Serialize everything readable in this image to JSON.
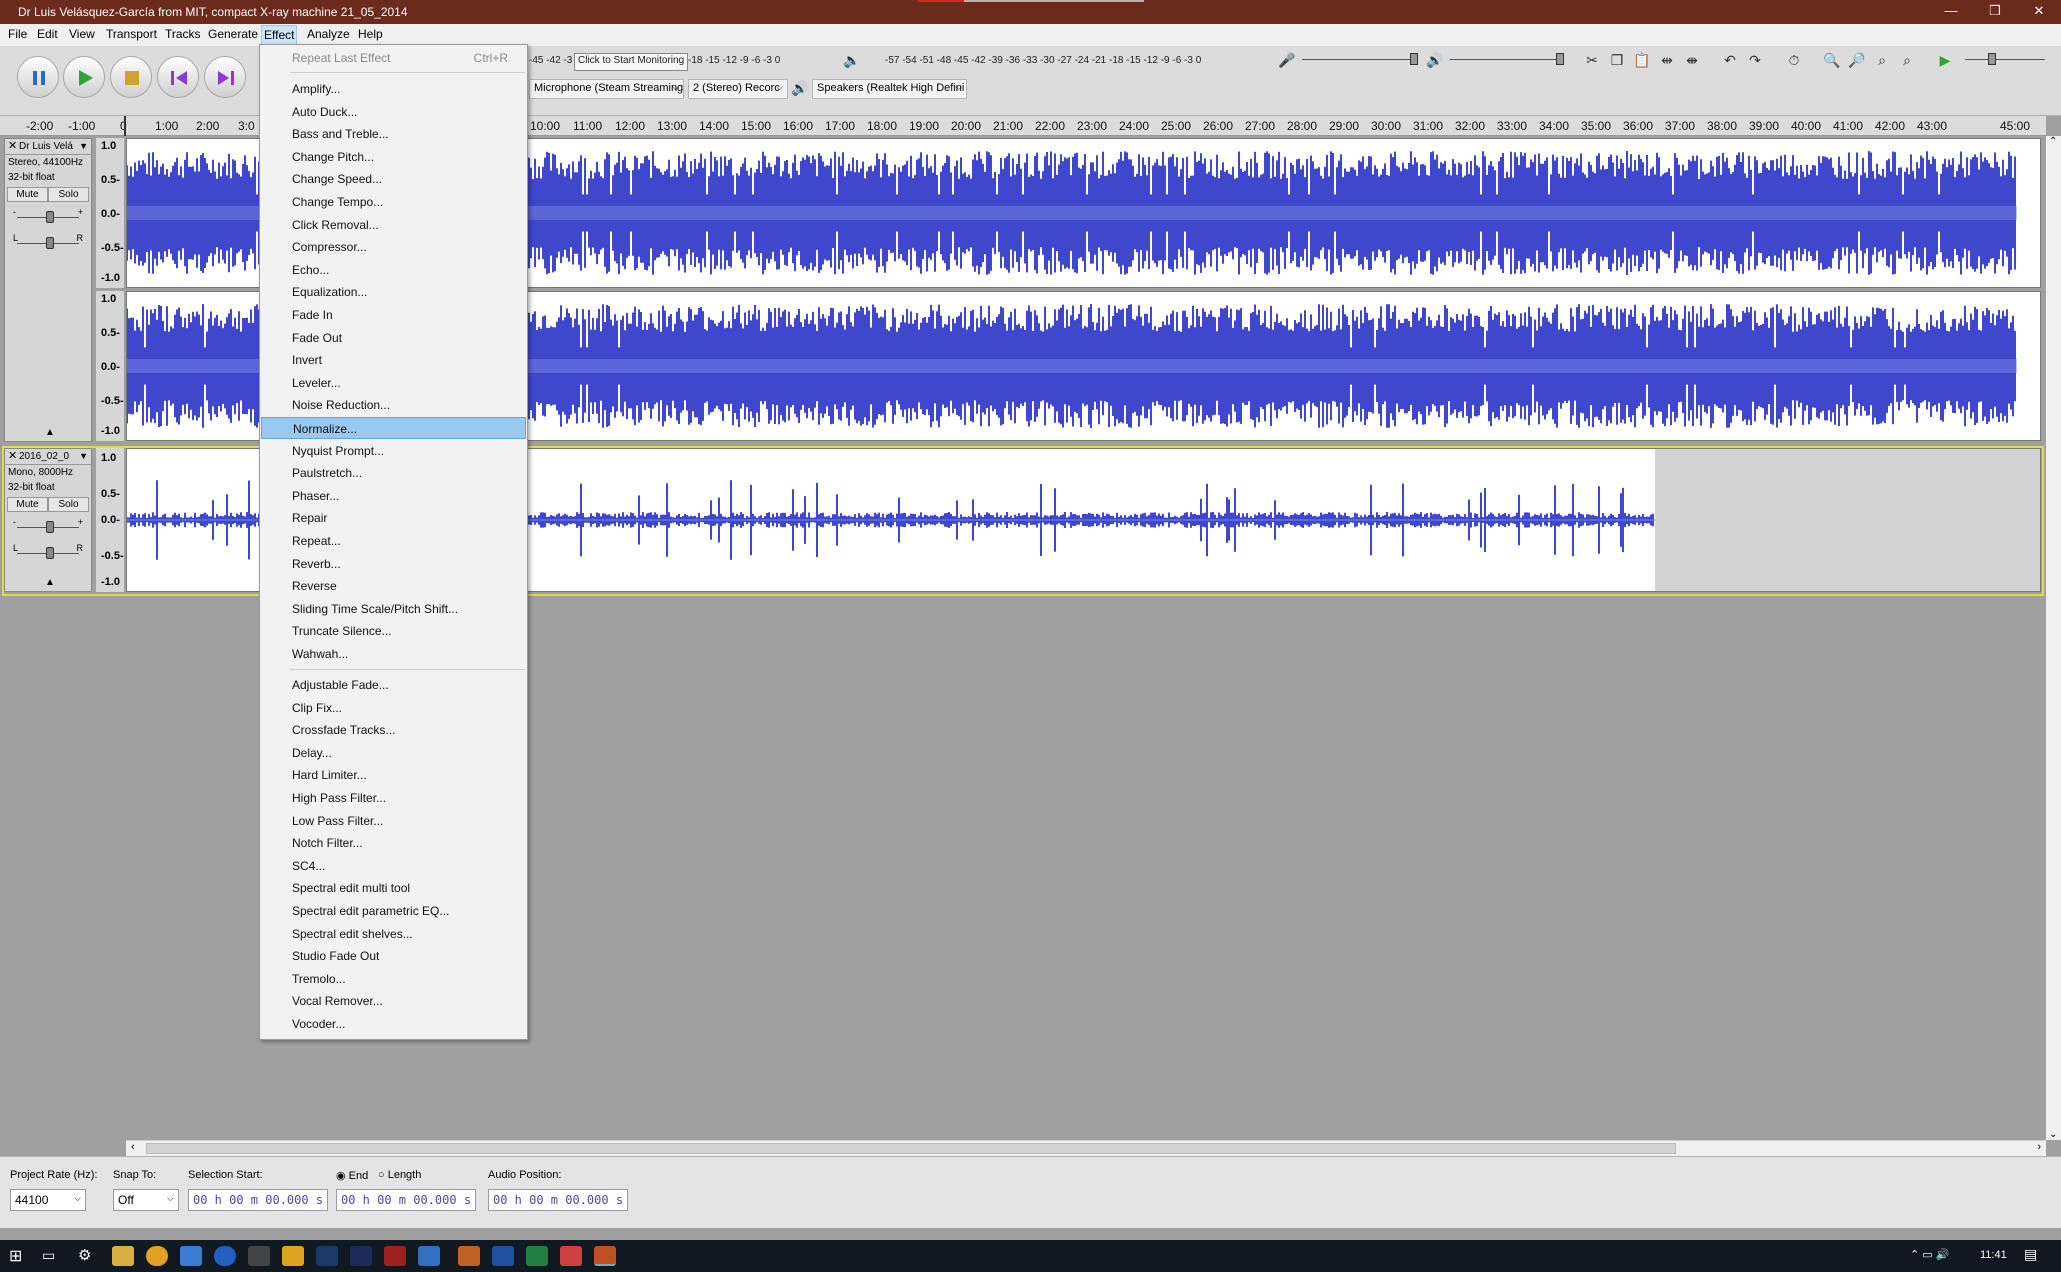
{
  "window": {
    "title": "Dr Luis Velásquez-García from MIT, compact X-ray machine 21_05_2014",
    "minimize": "—",
    "restore": "❐",
    "close": "✕"
  },
  "menubar": [
    "File",
    "Edit",
    "View",
    "Transport",
    "Tracks",
    "Generate",
    "Effect",
    "Analyze",
    "Help"
  ],
  "toolbar": {
    "rec_meter_ticks": "-45 -42 -3",
    "monitor_tip": "Click to Start Monitoring",
    "rec_meter_ticks2": "-18 -15 -12 -9 -6 -3 0",
    "play_meter_ticks": "-57 -54 -51 -48 -45 -42 -39 -36 -33 -30 -27 -24 -21 -18 -15 -12 -9 -6 -3 0",
    "mic_device": "Microphone (Steam Streaming",
    "channels": "2 (Stereo) Recorc",
    "speaker_device": "Speakers (Realtek High Defini"
  },
  "ruler": [
    "-2:00",
    "-1:00",
    "0",
    "1:00",
    "2:00",
    "3:0",
    "10:00",
    "11:00",
    "12:00",
    "13:00",
    "14:00",
    "15:00",
    "16:00",
    "17:00",
    "18:00",
    "19:00",
    "20:00",
    "21:00",
    "22:00",
    "23:00",
    "24:00",
    "25:00",
    "26:00",
    "27:00",
    "28:00",
    "29:00",
    "30:00",
    "31:00",
    "32:00",
    "33:00",
    "34:00",
    "35:00",
    "36:00",
    "37:00",
    "38:00",
    "39:00",
    "40:00",
    "41:00",
    "42:00",
    "43:00",
    "45:00"
  ],
  "tracks": [
    {
      "name": "Dr Luis Velá",
      "info1": "Stereo, 44100Hz",
      "info2": "32-bit float",
      "mute": "Mute",
      "solo": "Solo",
      "scale_top": [
        "1.0",
        "0.5-",
        "0.0-",
        "-0.5-",
        "-1.0"
      ],
      "scale_bot": [
        "1.0",
        "0.5-",
        "0.0-",
        "-0.5-",
        "-1.0"
      ]
    },
    {
      "name": "2016_02_0",
      "info1": "Mono, 8000Hz",
      "info2": "32-bit float",
      "mute": "Mute",
      "solo": "Solo",
      "scale": [
        "1.0",
        "0.5-",
        "0.0-",
        "-0.5-",
        "-1.0"
      ]
    }
  ],
  "effect_menu": {
    "repeat_last": "Repeat Last Effect",
    "repeat_shortcut": "Ctrl+R",
    "group1": [
      "Amplify...",
      "Auto Duck...",
      "Bass and Treble...",
      "Change Pitch...",
      "Change Speed...",
      "Change Tempo...",
      "Click Removal...",
      "Compressor...",
      "Echo...",
      "Equalization...",
      "Fade In",
      "Fade Out",
      "Invert",
      "Leveler...",
      "Noise Reduction...",
      "Normalize...",
      "Nyquist Prompt...",
      "Paulstretch...",
      "Phaser...",
      "Repair",
      "Repeat...",
      "Reverb...",
      "Reverse",
      "Sliding Time Scale/Pitch Shift...",
      "Truncate Silence...",
      "Wahwah..."
    ],
    "group2": [
      "Adjustable Fade...",
      "Clip Fix...",
      "Crossfade Tracks...",
      "Delay...",
      "Hard Limiter...",
      "High Pass Filter...",
      "Low Pass Filter...",
      "Notch Filter...",
      "SC4...",
      "Spectral edit multi tool",
      "Spectral edit parametric EQ...",
      "Spectral edit shelves...",
      "Studio Fade Out",
      "Tremolo...",
      "Vocal Remover...",
      "Vocoder..."
    ],
    "highlighted": "Normalize..."
  },
  "statusbar": {
    "project_rate_label": "Project Rate (Hz):",
    "project_rate": "44100",
    "snap_label": "Snap To:",
    "snap": "Off",
    "sel_start_label": "Selection Start:",
    "sel_start": "00 h 00 m 00.000 s",
    "end_label": "End",
    "length_label": "Length",
    "sel_end": "00 h 00 m 00.000 s",
    "audio_pos_label": "Audio Position:",
    "audio_pos": "00 h 00 m 00.000 s"
  },
  "taskbar": {
    "time": "11:41"
  },
  "colors": {
    "wave": "#3f48cc",
    "title": "#6b2b1c",
    "highlight": "#99c9ef"
  }
}
